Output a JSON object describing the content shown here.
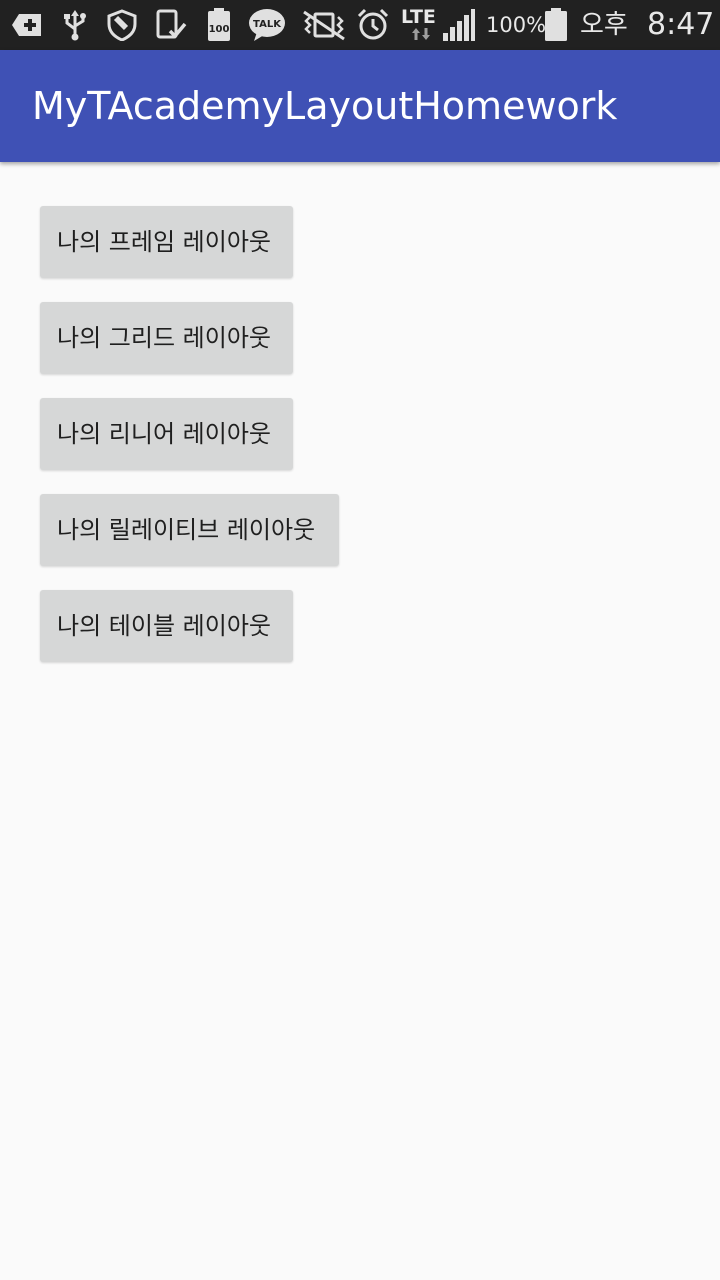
{
  "status_bar": {
    "battery_percent": "100%",
    "battery_icon_text": "100",
    "kakao_talk_text": "TALK",
    "network_type": "LTE",
    "am_pm": "오후",
    "time": "8:47"
  },
  "app_bar": {
    "title": "MyTAcademyLayoutHomework"
  },
  "buttons": [
    {
      "label": "나의 프레임 레이아웃"
    },
    {
      "label": "나의 그리드 레이아웃"
    },
    {
      "label": "나의 리니어 레이아웃"
    },
    {
      "label": "나의 릴레이티브 레이아웃"
    },
    {
      "label": "나의 테이블 레이아웃"
    }
  ],
  "colors": {
    "status_bar_bg": "#212121",
    "app_bar_bg": "#3f51b5",
    "page_bg": "#fafafa",
    "button_bg": "#d6d7d7"
  }
}
